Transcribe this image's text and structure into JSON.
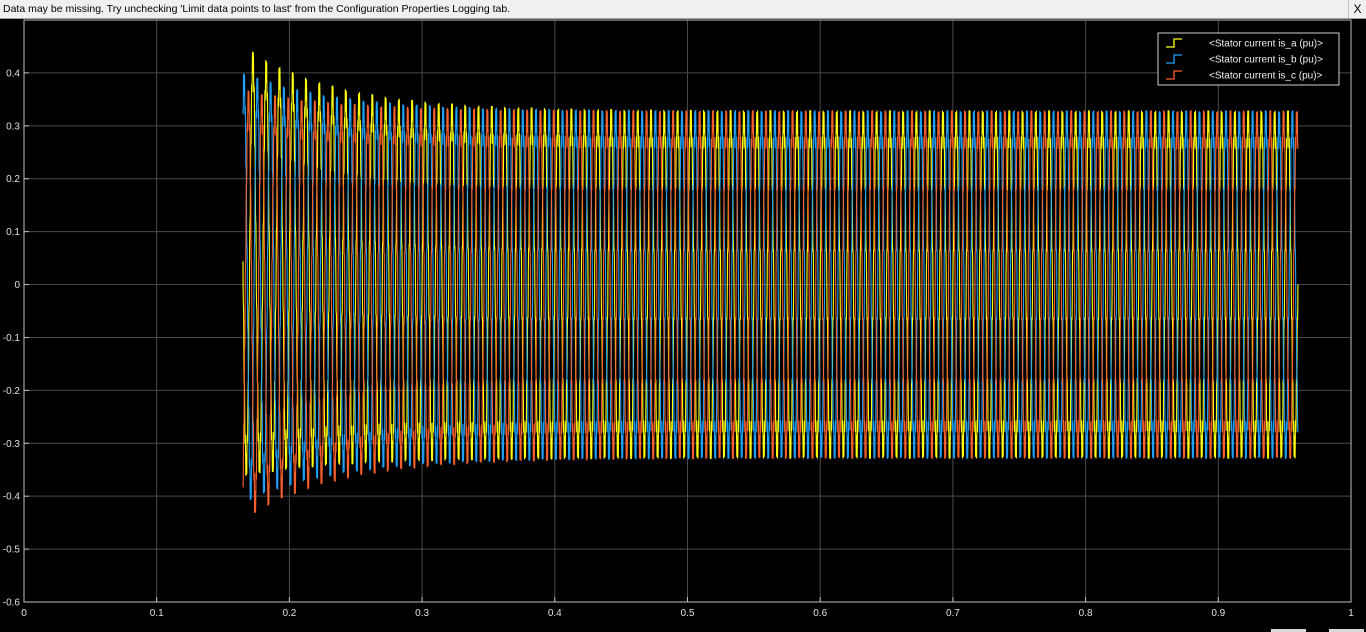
{
  "banner": {
    "message": "Data may be missing.  Try unchecking 'Limit data points to last' from the Configuration Properties Logging tab.",
    "close_label": "X"
  },
  "colors": {
    "background": "#000000",
    "grid": "#4a4a4a",
    "axes": "#bfbfbf",
    "legend_border": "#d0d0d0"
  },
  "chart_data": {
    "type": "line",
    "title": "",
    "xlabel": "",
    "ylabel": "",
    "xlim": [
      0,
      1
    ],
    "ylim": [
      -0.6,
      0.5
    ],
    "xticks": [
      0,
      0.1,
      0.2,
      0.3,
      0.4,
      0.5,
      0.6,
      0.7,
      0.8,
      0.9,
      1
    ],
    "xtick_labels": [
      "0",
      "0.1",
      "0.2",
      "0.3",
      "0.4",
      "0.5",
      "0.6",
      "0.7",
      "0.8",
      "0.9",
      "1"
    ],
    "yticks": [
      -0.6,
      -0.5,
      -0.4,
      -0.3,
      -0.2,
      -0.1,
      0,
      0.1,
      0.2,
      0.3,
      0.4
    ],
    "ytick_labels": [
      "-0.6",
      "-0.5",
      "-0.4",
      "-0.3",
      "-0.2",
      "-0.1",
      "0",
      "0.1",
      "0.2",
      "0.3",
      "0.4"
    ],
    "grid": true,
    "legend_position": "top-right",
    "signal": {
      "t_start": 0.165,
      "t_end": 0.96,
      "frequency_hz": 100,
      "steady_amplitude": 0.31,
      "transient_amplitude": 0.39,
      "transient_decay_s": 0.07,
      "ripple_amplitude": 0.025,
      "ripple_frequency_hz": 1500
    },
    "series": [
      {
        "name": "<Stator current is_a (pu)>",
        "color": "#ffff11",
        "phase_deg": 0
      },
      {
        "name": "<Stator current is_b (pu)>",
        "color": "#1fa1f7",
        "phase_deg": -120
      },
      {
        "name": "<Stator current is_c (pu)>",
        "color": "#f9612c",
        "phase_deg": 120
      }
    ]
  }
}
